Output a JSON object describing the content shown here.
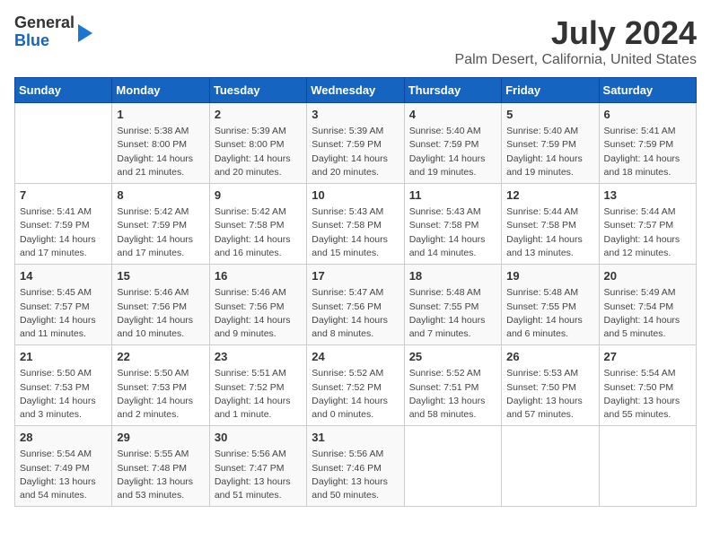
{
  "header": {
    "logo_line1": "General",
    "logo_line2": "Blue",
    "title": "July 2024",
    "subtitle": "Palm Desert, California, United States"
  },
  "days_of_week": [
    "Sunday",
    "Monday",
    "Tuesday",
    "Wednesday",
    "Thursday",
    "Friday",
    "Saturday"
  ],
  "weeks": [
    [
      {
        "day": "",
        "info": ""
      },
      {
        "day": "1",
        "info": "Sunrise: 5:38 AM\nSunset: 8:00 PM\nDaylight: 14 hours\nand 21 minutes."
      },
      {
        "day": "2",
        "info": "Sunrise: 5:39 AM\nSunset: 8:00 PM\nDaylight: 14 hours\nand 20 minutes."
      },
      {
        "day": "3",
        "info": "Sunrise: 5:39 AM\nSunset: 7:59 PM\nDaylight: 14 hours\nand 20 minutes."
      },
      {
        "day": "4",
        "info": "Sunrise: 5:40 AM\nSunset: 7:59 PM\nDaylight: 14 hours\nand 19 minutes."
      },
      {
        "day": "5",
        "info": "Sunrise: 5:40 AM\nSunset: 7:59 PM\nDaylight: 14 hours\nand 19 minutes."
      },
      {
        "day": "6",
        "info": "Sunrise: 5:41 AM\nSunset: 7:59 PM\nDaylight: 14 hours\nand 18 minutes."
      }
    ],
    [
      {
        "day": "7",
        "info": "Sunrise: 5:41 AM\nSunset: 7:59 PM\nDaylight: 14 hours\nand 17 minutes."
      },
      {
        "day": "8",
        "info": "Sunrise: 5:42 AM\nSunset: 7:59 PM\nDaylight: 14 hours\nand 17 minutes."
      },
      {
        "day": "9",
        "info": "Sunrise: 5:42 AM\nSunset: 7:58 PM\nDaylight: 14 hours\nand 16 minutes."
      },
      {
        "day": "10",
        "info": "Sunrise: 5:43 AM\nSunset: 7:58 PM\nDaylight: 14 hours\nand 15 minutes."
      },
      {
        "day": "11",
        "info": "Sunrise: 5:43 AM\nSunset: 7:58 PM\nDaylight: 14 hours\nand 14 minutes."
      },
      {
        "day": "12",
        "info": "Sunrise: 5:44 AM\nSunset: 7:58 PM\nDaylight: 14 hours\nand 13 minutes."
      },
      {
        "day": "13",
        "info": "Sunrise: 5:44 AM\nSunset: 7:57 PM\nDaylight: 14 hours\nand 12 minutes."
      }
    ],
    [
      {
        "day": "14",
        "info": "Sunrise: 5:45 AM\nSunset: 7:57 PM\nDaylight: 14 hours\nand 11 minutes."
      },
      {
        "day": "15",
        "info": "Sunrise: 5:46 AM\nSunset: 7:56 PM\nDaylight: 14 hours\nand 10 minutes."
      },
      {
        "day": "16",
        "info": "Sunrise: 5:46 AM\nSunset: 7:56 PM\nDaylight: 14 hours\nand 9 minutes."
      },
      {
        "day": "17",
        "info": "Sunrise: 5:47 AM\nSunset: 7:56 PM\nDaylight: 14 hours\nand 8 minutes."
      },
      {
        "day": "18",
        "info": "Sunrise: 5:48 AM\nSunset: 7:55 PM\nDaylight: 14 hours\nand 7 minutes."
      },
      {
        "day": "19",
        "info": "Sunrise: 5:48 AM\nSunset: 7:55 PM\nDaylight: 14 hours\nand 6 minutes."
      },
      {
        "day": "20",
        "info": "Sunrise: 5:49 AM\nSunset: 7:54 PM\nDaylight: 14 hours\nand 5 minutes."
      }
    ],
    [
      {
        "day": "21",
        "info": "Sunrise: 5:50 AM\nSunset: 7:53 PM\nDaylight: 14 hours\nand 3 minutes."
      },
      {
        "day": "22",
        "info": "Sunrise: 5:50 AM\nSunset: 7:53 PM\nDaylight: 14 hours\nand 2 minutes."
      },
      {
        "day": "23",
        "info": "Sunrise: 5:51 AM\nSunset: 7:52 PM\nDaylight: 14 hours\nand 1 minute."
      },
      {
        "day": "24",
        "info": "Sunrise: 5:52 AM\nSunset: 7:52 PM\nDaylight: 14 hours\nand 0 minutes."
      },
      {
        "day": "25",
        "info": "Sunrise: 5:52 AM\nSunset: 7:51 PM\nDaylight: 13 hours\nand 58 minutes."
      },
      {
        "day": "26",
        "info": "Sunrise: 5:53 AM\nSunset: 7:50 PM\nDaylight: 13 hours\nand 57 minutes."
      },
      {
        "day": "27",
        "info": "Sunrise: 5:54 AM\nSunset: 7:50 PM\nDaylight: 13 hours\nand 55 minutes."
      }
    ],
    [
      {
        "day": "28",
        "info": "Sunrise: 5:54 AM\nSunset: 7:49 PM\nDaylight: 13 hours\nand 54 minutes."
      },
      {
        "day": "29",
        "info": "Sunrise: 5:55 AM\nSunset: 7:48 PM\nDaylight: 13 hours\nand 53 minutes."
      },
      {
        "day": "30",
        "info": "Sunrise: 5:56 AM\nSunset: 7:47 PM\nDaylight: 13 hours\nand 51 minutes."
      },
      {
        "day": "31",
        "info": "Sunrise: 5:56 AM\nSunset: 7:46 PM\nDaylight: 13 hours\nand 50 minutes."
      },
      {
        "day": "",
        "info": ""
      },
      {
        "day": "",
        "info": ""
      },
      {
        "day": "",
        "info": ""
      }
    ]
  ]
}
